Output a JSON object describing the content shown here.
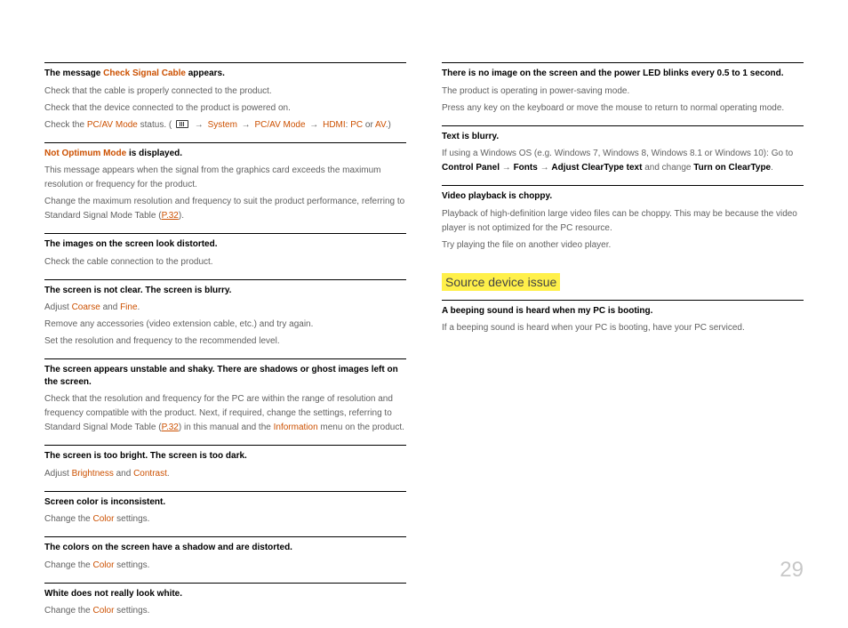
{
  "page_number": "29",
  "left_column": [
    {
      "heading_parts": [
        {
          "text": "The message ",
          "style": ""
        },
        {
          "text": "Check Signal Cable",
          "style": "orange"
        },
        {
          "text": " appears.",
          "style": ""
        }
      ],
      "body": [
        [
          {
            "text": "Check that the cable is properly connected to the product."
          }
        ],
        [
          {
            "text": "Check that the device connected to the product is powered on."
          }
        ],
        [
          {
            "text": "Check the "
          },
          {
            "text": "PC/AV Mode",
            "style": "orange"
          },
          {
            "text": " status. ( "
          },
          {
            "text": "ICON",
            "style": "icon"
          },
          {
            "text": " → ",
            "style": "arrow"
          },
          {
            "text": "System",
            "style": "orange"
          },
          {
            "text": " → ",
            "style": "arrow"
          },
          {
            "text": "PC/AV Mode",
            "style": "orange"
          },
          {
            "text": " → ",
            "style": "arrow"
          },
          {
            "text": "HDMI",
            "style": "orange"
          },
          {
            "text": ": "
          },
          {
            "text": "PC",
            "style": "orange"
          },
          {
            "text": " or "
          },
          {
            "text": "AV",
            "style": "orange"
          },
          {
            "text": ".)"
          }
        ]
      ]
    },
    {
      "heading_parts": [
        {
          "text": "Not Optimum Mode",
          "style": "orange"
        },
        {
          "text": " is displayed.",
          "style": ""
        }
      ],
      "body": [
        [
          {
            "text": "This message appears when the signal from the graphics card exceeds the maximum resolution or frequency for the product."
          }
        ],
        [
          {
            "text": "Change the maximum resolution and frequency to suit the product performance, referring to Standard Signal Mode Table ("
          },
          {
            "text": "P.32",
            "style": "link"
          },
          {
            "text": ")."
          }
        ]
      ]
    },
    {
      "heading_parts": [
        {
          "text": "The images on the screen look distorted."
        }
      ],
      "body": [
        [
          {
            "text": "Check the cable connection to the product."
          }
        ]
      ]
    },
    {
      "heading_parts": [
        {
          "text": "The screen is not clear. The screen is blurry."
        }
      ],
      "body": [
        [
          {
            "text": "Adjust "
          },
          {
            "text": "Coarse",
            "style": "orange"
          },
          {
            "text": " and "
          },
          {
            "text": "Fine",
            "style": "orange"
          },
          {
            "text": "."
          }
        ],
        [
          {
            "text": "Remove any accessories (video extension cable, etc.) and try again."
          }
        ],
        [
          {
            "text": "Set the resolution and frequency to the recommended level."
          }
        ]
      ]
    },
    {
      "heading_parts": [
        {
          "text": "The screen appears unstable and shaky. There are shadows or ghost images left on the screen."
        }
      ],
      "body": [
        [
          {
            "text": "Check that the resolution and frequency for the PC are within the range of resolution and frequency compatible with the product. Next, if required, change the settings, referring to Standard Signal Mode Table ("
          },
          {
            "text": "P.32",
            "style": "link"
          },
          {
            "text": ") in this manual and the "
          },
          {
            "text": "Information",
            "style": "orange"
          },
          {
            "text": " menu on the product."
          }
        ]
      ]
    },
    {
      "heading_parts": [
        {
          "text": "The screen is too bright. The screen is too dark."
        }
      ],
      "body": [
        [
          {
            "text": "Adjust "
          },
          {
            "text": "Brightness",
            "style": "orange"
          },
          {
            "text": " and "
          },
          {
            "text": "Contrast",
            "style": "orange"
          },
          {
            "text": "."
          }
        ]
      ]
    },
    {
      "heading_parts": [
        {
          "text": "Screen color  is inconsistent."
        }
      ],
      "body": [
        [
          {
            "text": "Change the "
          },
          {
            "text": "Color",
            "style": "orange"
          },
          {
            "text": " settings."
          }
        ]
      ]
    },
    {
      "heading_parts": [
        {
          "text": "The colors on the screen have a shadow and are distorted."
        }
      ],
      "body": [
        [
          {
            "text": "Change the "
          },
          {
            "text": "Color",
            "style": "orange"
          },
          {
            "text": " settings."
          }
        ]
      ]
    },
    {
      "heading_parts": [
        {
          "text": "White does not really look white."
        }
      ],
      "body": [
        [
          {
            "text": "Change the "
          },
          {
            "text": "Color",
            "style": "orange"
          },
          {
            "text": " settings."
          }
        ]
      ]
    }
  ],
  "right_column": {
    "blocks": [
      {
        "heading_parts": [
          {
            "text": "There is no image on the screen and the power LED blinks every 0.5 to 1 second."
          }
        ],
        "body": [
          [
            {
              "text": "The product is operating in power-saving mode."
            }
          ],
          [
            {
              "text": "Press any key on the keyboard or move the mouse to return to normal operating mode."
            }
          ]
        ]
      },
      {
        "heading_parts": [
          {
            "text": "Text is blurry."
          }
        ],
        "body": [
          [
            {
              "text": "If using a Windows OS (e.g. Windows 7, Windows 8, Windows 8.1 or Windows 10): Go to "
            },
            {
              "text": "Control Panel",
              "style": "bold-black"
            },
            {
              "text": " → "
            },
            {
              "text": "Fonts",
              "style": "bold-black"
            },
            {
              "text": " → "
            },
            {
              "text": "Adjust ClearType text",
              "style": "bold-black"
            },
            {
              "text": " and change "
            },
            {
              "text": "Turn on ClearType",
              "style": "bold-black"
            },
            {
              "text": "."
            }
          ]
        ]
      },
      {
        "heading_parts": [
          {
            "text": "Video playback is choppy."
          }
        ],
        "body": [
          [
            {
              "text": "Playback of high-definition large video files can be choppy. This may be because the video player is not optimized for the PC resource."
            }
          ],
          [
            {
              "text": "Try playing the file on another video player."
            }
          ]
        ]
      }
    ],
    "section_title": "Source device issue",
    "blocks2": [
      {
        "heading_parts": [
          {
            "text": "A beeping sound is heard when my PC is booting."
          }
        ],
        "body": [
          [
            {
              "text": "If a beeping sound is heard when your PC is booting, have your PC serviced."
            }
          ]
        ]
      }
    ]
  }
}
